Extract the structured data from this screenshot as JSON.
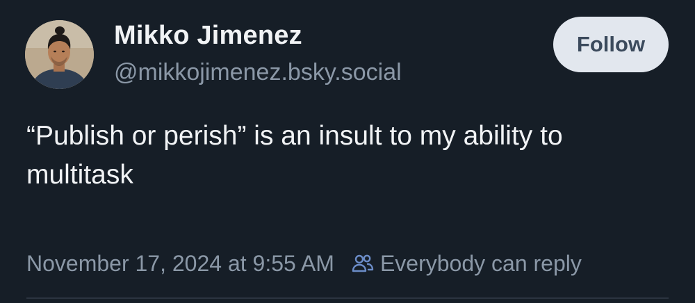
{
  "author": {
    "display_name": "Mikko Jimenez",
    "handle": "@mikkojimenez.bsky.social"
  },
  "follow_button": {
    "label": "Follow"
  },
  "post": {
    "text": "“Publish or perish” is an insult to my ability to multitask",
    "timestamp": "November 17, 2024 at 9:55 AM",
    "reply_setting": "Everybody can reply",
    "reply_icon": "people-icon"
  },
  "colors": {
    "background": "#161e27",
    "primary_text": "#f1f3f5",
    "secondary_text": "#8b98a7",
    "follow_button_bg": "#e2e7ee",
    "follow_button_text": "#3b4a5c",
    "icon_blue": "#6b8cc7"
  }
}
